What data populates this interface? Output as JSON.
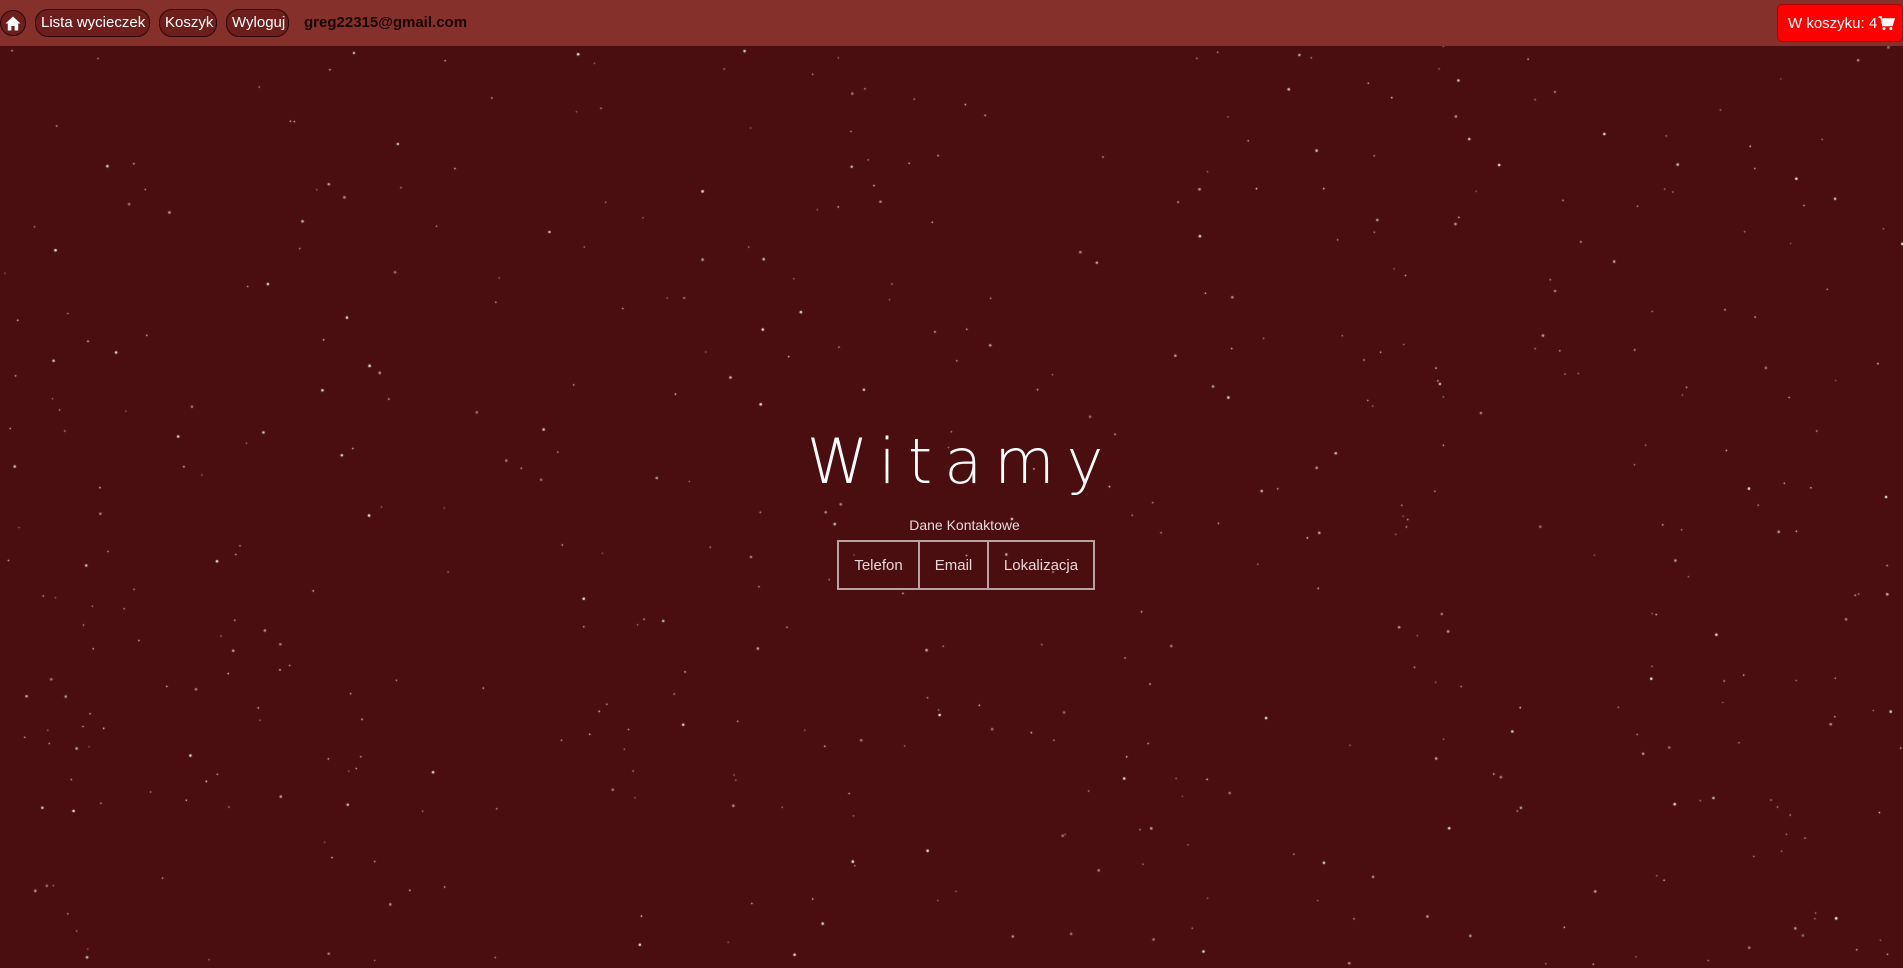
{
  "navbar": {
    "home_icon": "home-icon",
    "links": [
      "Lista wycieczek",
      "Koszyk",
      "Wyloguj"
    ],
    "user_email": "greg22315@gmail.com",
    "cart_label": "W koszyku: 4",
    "cart_icon": "shopping-cart-icon"
  },
  "hero": {
    "title": "Witamy",
    "contact_label": "Dane Kontaktowe",
    "contact_buttons": [
      "Telefon",
      "Email",
      "Lokalizacja"
    ]
  },
  "colors": {
    "navbar_bg": "#85302a",
    "page_bg": "#4a0e10",
    "cart_bg": "#ff0000",
    "text": "#ffffff"
  }
}
